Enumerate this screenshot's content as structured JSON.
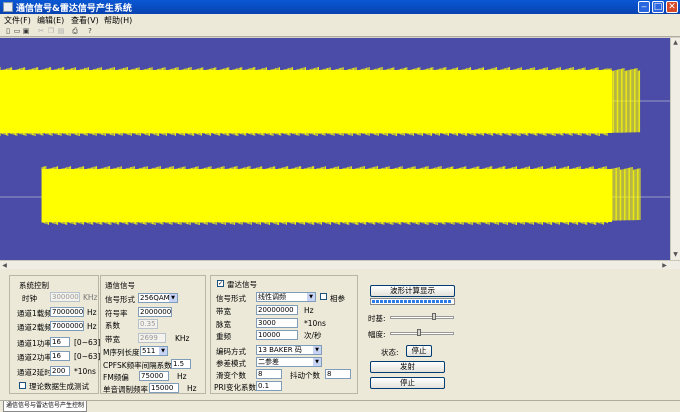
{
  "window": {
    "title": "通信信号&雷达信号产生系统"
  },
  "menu": [
    "文件(F)",
    "编辑(E)",
    "查看(V)",
    "帮助(H)"
  ],
  "toolbar": {
    "icons": [
      "new-icon",
      "open-icon",
      "save-icon",
      "cut-icon",
      "copy-icon",
      "paste-icon",
      "print-icon",
      "help-icon"
    ]
  },
  "plot": {
    "background": "#4b4ba8",
    "signal_color": "#ffff00"
  },
  "system": {
    "title": "系统控制",
    "clock_label": "时钟",
    "clock_value": "300000",
    "clock_unit": "KHz",
    "ch1_freq_label": "通道1载频",
    "ch1_freq_value": "70000000",
    "ch1_freq_unit": "Hz",
    "ch2_freq_label": "通道2载频",
    "ch2_freq_value": "70000000",
    "ch2_freq_unit": "Hz",
    "ch1_power_label": "通道1功率",
    "ch1_power_value": "16",
    "ch1_power_range": "[0~63]",
    "ch2_power_label": "通道2功率",
    "ch2_power_value": "16",
    "ch2_power_range": "[0~63]",
    "ch2_delay_label": "通道2延时",
    "ch2_delay_value": "200",
    "ch2_delay_unit": "*10ns",
    "theory_label": "理论数据生成测试"
  },
  "comm": {
    "title": "通信信号",
    "form_label": "信号形式",
    "form_value": "256QAM",
    "symrate_label": "符号率",
    "symrate_value": "2000000",
    "coef_label": "系数",
    "coef_value": "0.35",
    "bw_label": "带宽",
    "bw_value": "2699",
    "bw_unit": "KHz",
    "mlen_label": "M序列长度",
    "mlen_value": "511",
    "cpfsk_label": "CPFSK频率间隔系数",
    "cpfsk_value": "1.5",
    "fm_label": "FM频偏",
    "fm_value": "75000",
    "fm_unit": "Hz",
    "tone_label": "单音调制频率",
    "tone_value": "15000",
    "tone_unit": "Hz"
  },
  "radar": {
    "enable_label": "雷达信号",
    "form_label": "信号形式",
    "form_value": "线性调频",
    "coherent_label": "相参",
    "bw_label": "带宽",
    "bw_value": "20000000",
    "bw_unit": "Hz",
    "pw_label": "脉宽",
    "pw_value": "3000",
    "pw_unit": "*10ns",
    "rep_label": "重频",
    "rep_value": "10000",
    "rep_unit": "次/秒",
    "code_label": "编码方式",
    "code_value": "13 BAKER 码",
    "mode_label": "参差模式",
    "mode_value": "二参差",
    "slide_label": "滑变个数",
    "slide_value": "8",
    "jitter_label": "抖动个数",
    "jitter_value": "8",
    "pri_label": "PRI变化系数",
    "pri_value": "0.1"
  },
  "control": {
    "wave_button": "波形计算显示",
    "progress": 1.0,
    "timebase_label": "时基:",
    "timebase_level": 0.7,
    "amp_label": "幅度:",
    "amp_level": 0.45,
    "status_label": "状态:",
    "stop_label": "停止",
    "send_button": "发射",
    "stop_button": "停止"
  },
  "status": {
    "tab": "通信信号与雷达信号产生控制"
  }
}
